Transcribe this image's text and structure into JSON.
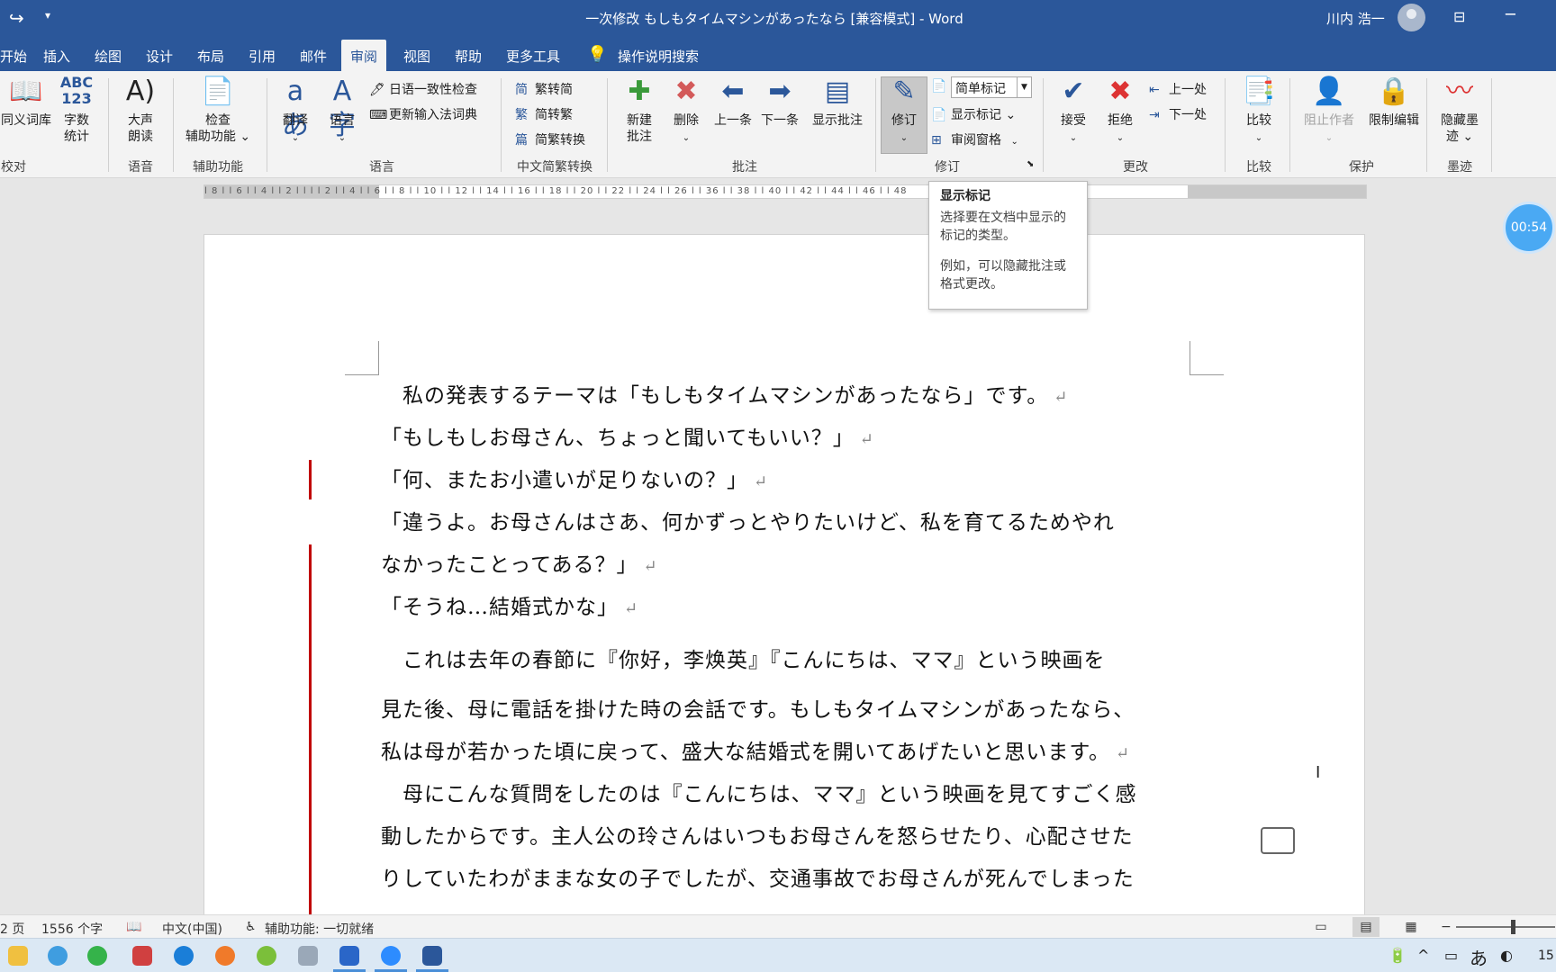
{
  "window": {
    "title": "一次修改 もしもタイムマシンがあったなら [兼容模式] - Word",
    "user": "川内 浩一"
  },
  "tabs": [
    "开始",
    "插入",
    "绘图",
    "设计",
    "布局",
    "引用",
    "邮件",
    "审阅",
    "视图",
    "帮助",
    "更多工具"
  ],
  "active_tab": "审阅",
  "tell_me": "操作说明搜索",
  "ribbon": {
    "thesaurus": "同义词库",
    "word_count_line1": "字数",
    "word_count_line2": "统计",
    "read_aloud_line1": "大声",
    "read_aloud_line2": "朗读",
    "check_access_line1": "检查",
    "check_access_line2": "辅助功能 ⌄",
    "translate": "翻译",
    "language": "语言",
    "ja_consistency": "日语一致性检查",
    "update_ime": "更新输入法词典",
    "t2s": "繁转简",
    "s2t": "简转繁",
    "convert": "简繁转换",
    "new_comment_line1": "新建",
    "new_comment_line2": "批注",
    "delete": "删除",
    "prev_comment": "上一条",
    "next_comment": "下一条",
    "show_comments": "显示批注",
    "track_changes": "修订",
    "markup_mode": "简单标记",
    "show_markup": "显示标记 ⌄",
    "review_pane": "审阅窗格",
    "accept": "接受",
    "reject": "拒绝",
    "prev_change": "上一处",
    "next_change": "下一处",
    "compare": "比较",
    "block_authors": "阻止作者",
    "restrict_editing": "限制编辑",
    "hide_ink_line1": "隐藏墨",
    "hide_ink_line2": "迹 ⌄",
    "groups": {
      "proofing": "校对",
      "speech": "语音",
      "accessibility": "辅助功能",
      "language": "语言",
      "chinese_conversion": "中文简繁转换",
      "comments": "批注",
      "tracking": "修订",
      "changes": "更改",
      "compare": "比较",
      "protect": "保护",
      "ink": "墨迹"
    }
  },
  "ruler": {
    "labels": "l 8 l l 6 l l 4 l l 2 l l l    l 2 l l 4 l l 6 l l 8 l l 10 l l 12 l l 14 l l 16 l l 18 l l 20 l l 22 l l 24 l l 26 l                        l 36 l l 38 l l 40 l l 42 l l 44 l l 46 l l 48"
  },
  "timer": "00:54",
  "tooltip": {
    "title": "显示标记",
    "line1": "选择要在文档中显示的标记的类型。",
    "line2": "例如，可以隐藏批注或格式更改。"
  },
  "document": {
    "paragraph_mark": "↵",
    "lines": [
      "　私の発表するテーマは「もしもタイムマシンがあったなら」です。",
      "「もしもしお母さん、ちょっと聞いてもいい？」",
      "「何、またお小遣いが足りないの？」",
      "「違うよ。お母さんはさあ、何かずっとやりたいけど、私を育てるためやれ",
      "なかったことってある？」",
      "「そうね…結婚式かな」",
      "　これは去年の春節に『你好，李焕英』『こんにちは、ママ』という映画を",
      "見た後、母に電話を掛けた時の会話です。もしもタイムマシンがあったなら、",
      "私は母が若かった頃に戻って、盛大な結婚式を開いてあげたいと思います。",
      "　母にこんな質問をしたのは『こんにちは、ママ』という映画を見てすごく感",
      "動したからです。主人公の玲さんはいつもお母さんを怒らせたり、心配させた",
      "りしていたわがままな女の子でしたが、交通事故でお母さんが死んでしまった"
    ]
  },
  "statusbar": {
    "page": "2 页",
    "words": "1556 个字",
    "language": "中文(中国)",
    "accessibility": "辅助功能: 一切就绪"
  },
  "taskbar": {
    "ime": "あ",
    "clock_partial": "15"
  },
  "colors": {
    "title_bar": "#2b579a",
    "change_bar": "#c00000",
    "timer": "#4aa9f3"
  }
}
